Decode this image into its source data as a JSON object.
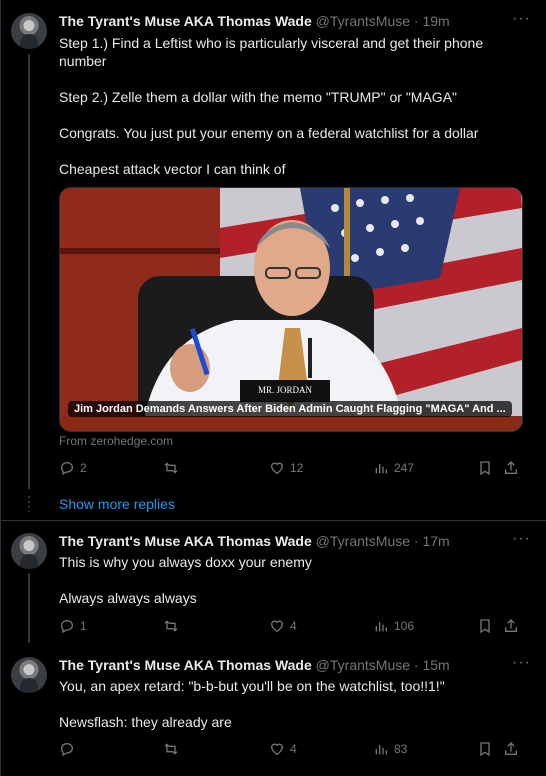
{
  "tweets": [
    {
      "name": "The Tyrant's Muse AKA Thomas Wade",
      "handle": "@TyrantsMuse",
      "time": "19m",
      "paragraphs": [
        "Step 1.) Find a Leftist who is particularly visceral and get their phone number",
        "Step 2.) Zelle them a dollar with the memo \"TRUMP\" or \"MAGA\"",
        "Congrats.  You just put your enemy on a federal watchlist for a dollar",
        "Cheapest attack vector I can think of"
      ],
      "card": {
        "caption": "Jim Jordan Demands Answers After Biden Admin Caught Flagging \"MAGA\" And ...",
        "nameplate": "MR. JORDAN",
        "source": "From zerohedge.com"
      },
      "stats": {
        "replies": "2",
        "retweets": "",
        "likes": "12",
        "views": "247"
      }
    },
    {
      "name": "The Tyrant's Muse AKA Thomas Wade",
      "handle": "@TyrantsMuse",
      "time": "17m",
      "paragraphs": [
        "This is why you always doxx your enemy",
        "Always always always"
      ],
      "stats": {
        "replies": "1",
        "retweets": "",
        "likes": "4",
        "views": "106"
      }
    },
    {
      "name": "The Tyrant's Muse AKA Thomas Wade",
      "handle": "@TyrantsMuse",
      "time": "15m",
      "paragraphs": [
        "You, an apex retard: \"b-b-but you'll be on the watchlist, too!!1!\"",
        "Newsflash: they already are"
      ],
      "stats": {
        "replies": "",
        "retweets": "",
        "likes": "4",
        "views": "83"
      }
    }
  ],
  "show_more_replies": "Show more replies",
  "colors": {
    "background": "#000000",
    "text": "#e7e9ea",
    "muted": "#71767b",
    "link": "#1d9bf0"
  }
}
